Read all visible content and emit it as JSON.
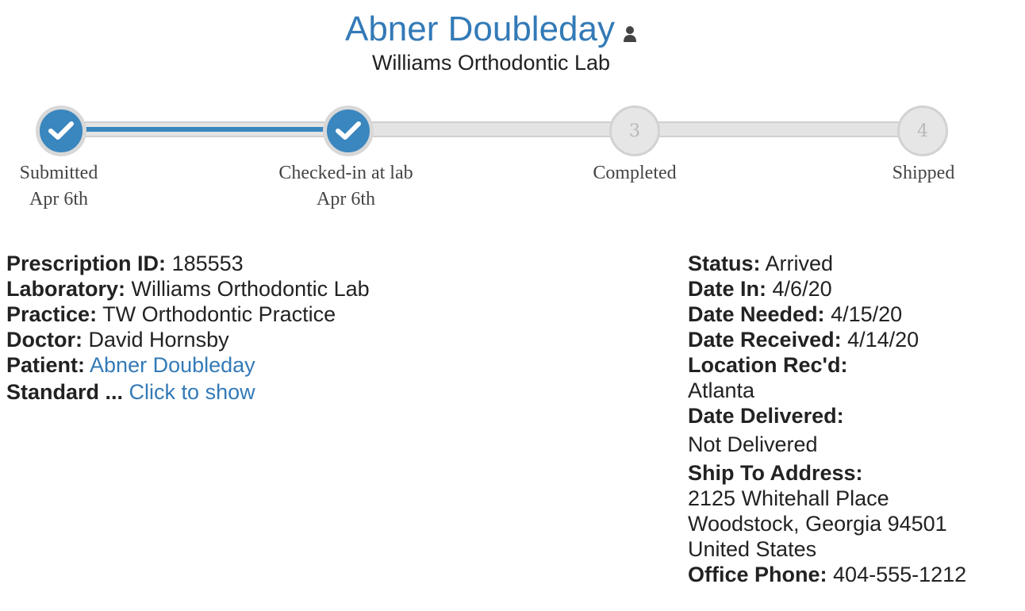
{
  "header": {
    "patient_name": "Abner Doubleday",
    "lab_name": "Williams Orthodontic Lab"
  },
  "progress": {
    "steps": [
      {
        "number": "1",
        "label": "Submitted",
        "date": "Apr 6th",
        "done": true
      },
      {
        "number": "2",
        "label": "Checked-in at lab",
        "date": "Apr 6th",
        "done": true
      },
      {
        "number": "3",
        "label": "Completed",
        "date": "",
        "done": false
      },
      {
        "number": "4",
        "label": "Shipped",
        "date": "",
        "done": false
      }
    ],
    "completed_fraction": 0.333,
    "active_color": "#3a86bf",
    "inactive_color": "#e4e4e4"
  },
  "details": {
    "prescription_id_label": "Prescription ID:",
    "prescription_id": "185553",
    "laboratory_label": "Laboratory:",
    "laboratory": "Williams Orthodontic Lab",
    "practice_label": "Practice:",
    "practice": "TW Orthodontic Practice",
    "doctor_label": "Doctor:",
    "doctor": "David Hornsby",
    "patient_label": "Patient:",
    "patient": "Abner Doubleday",
    "standard_label": "Standard ...",
    "standard_link": "Click to show"
  },
  "status": {
    "status_label": "Status:",
    "status": "Arrived",
    "date_in_label": "Date In:",
    "date_in": "4/6/20",
    "date_needed_label": "Date Needed:",
    "date_needed": "4/15/20",
    "date_received_label": "Date Received:",
    "date_received": "4/14/20",
    "location_label": "Location Rec'd:",
    "location": "Atlanta",
    "date_delivered_label": "Date Delivered:",
    "date_delivered": "Not Delivered",
    "ship_to_label": "Ship To Address:",
    "address_line1": "2125 Whitehall Place",
    "address_line2": "Woodstock, Georgia 94501",
    "address_line3": "United States",
    "office_phone_label": "Office Phone:",
    "office_phone": "404-555-1212"
  },
  "colors": {
    "link": "#337ab7",
    "text": "#222222"
  }
}
